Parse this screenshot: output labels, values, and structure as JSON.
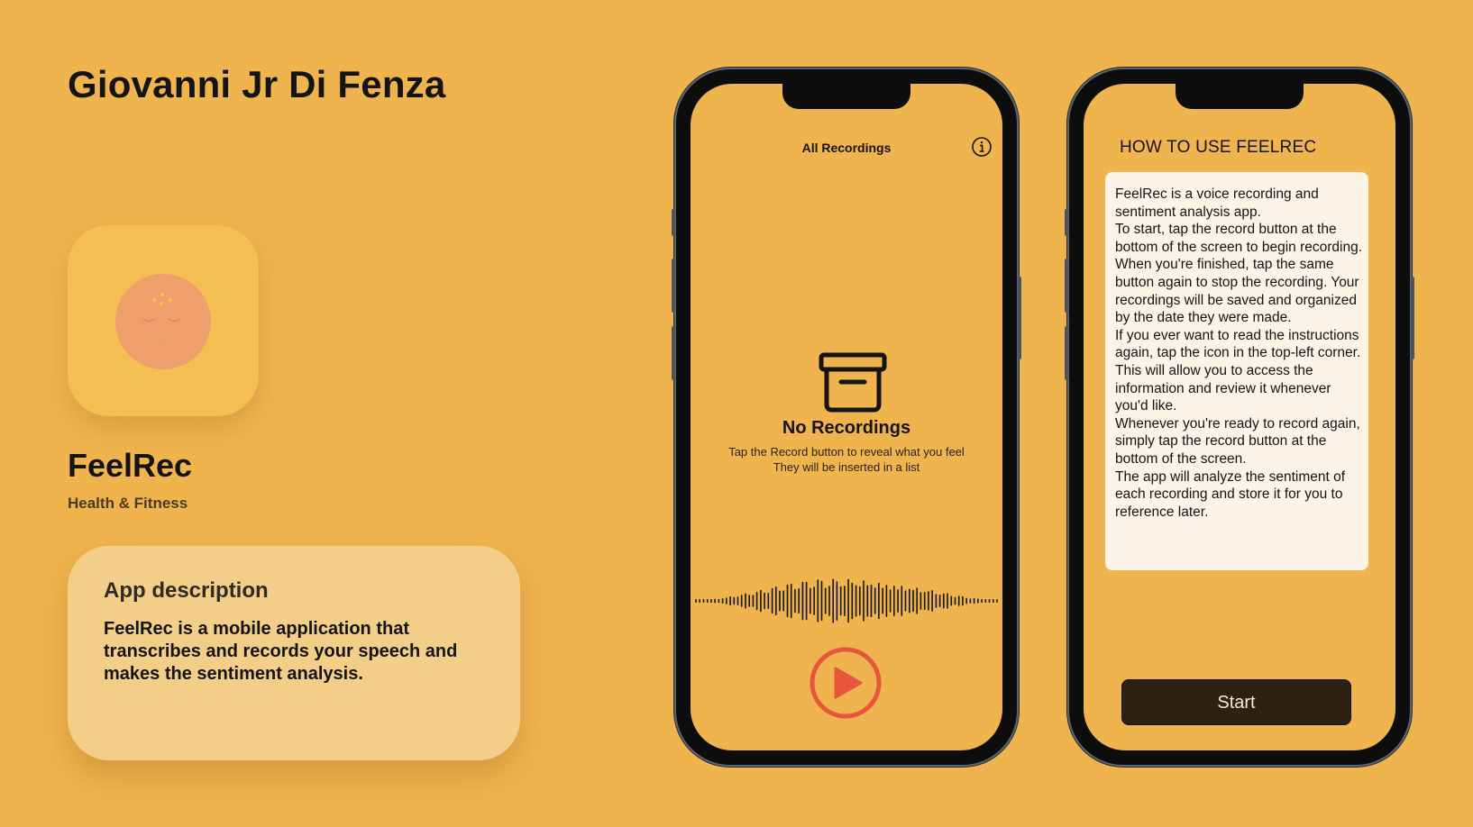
{
  "author": "Giovanni Jr Di Fenza",
  "app": {
    "name": "FeelRec",
    "category": "Health & Fitness",
    "description_title": "App description",
    "description": "FeelRec is a mobile application that transcribes and records your speech and makes the sentiment analysis."
  },
  "recordings_screen": {
    "title": "All Recordings",
    "info_icon": "info-circle-icon",
    "empty_icon": "archive-box-icon",
    "empty_title": "No Recordings",
    "empty_line1": "Tap the Record button to reveal what you feel",
    "empty_line2": "They will be inserted in a list",
    "record_icon": "play-circle-icon",
    "record_color": "#E8553D"
  },
  "howto_screen": {
    "title": "HOW TO USE FEELREC",
    "instructions": "FeelRec is a voice recording and sentiment analysis app.\nTo start, tap the record button at the bottom of the screen to begin recording.\nWhen you're finished, tap the same button again to stop the recording. Your recordings will be saved and organized by the date they were made.\nIf you ever want to read the instructions again, tap the icon in the top-left corner. This will allow you to access the information and review it whenever you'd like.\nWhenever you're ready to record again, simply tap the record button at the bottom of the screen.\nThe app will analyze the sentiment of each recording and store it for you to reference later.",
    "start_label": "Start"
  },
  "colors": {
    "background": "#EFB44E",
    "icon_face": "#EE9F6C",
    "card": "#F2CE88",
    "start_button": "#2D2111"
  }
}
